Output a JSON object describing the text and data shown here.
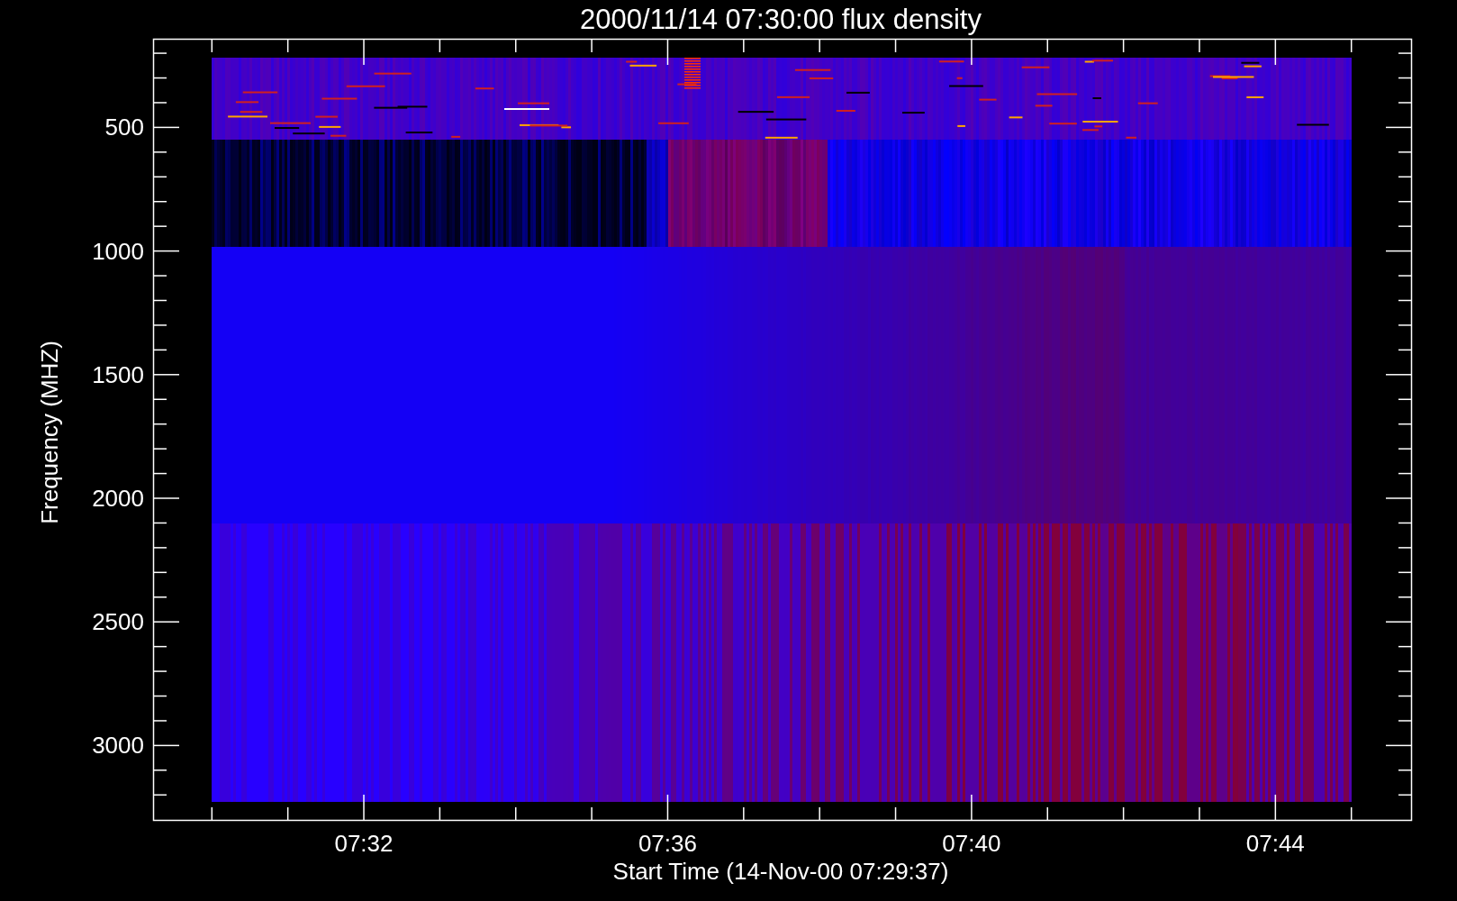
{
  "plot": {
    "title": "2000/11/14 07:30:00 flux density",
    "ylabel": "Frequency (MHZ)",
    "xlabel": "Start Time (14-Nov-00 07:29:37)",
    "yticks": [
      "500",
      "1000",
      "1500",
      "2000",
      "2500",
      "3000"
    ],
    "xticks": [
      "07:32",
      "07:36",
      "07:40",
      "07:44"
    ]
  }
}
